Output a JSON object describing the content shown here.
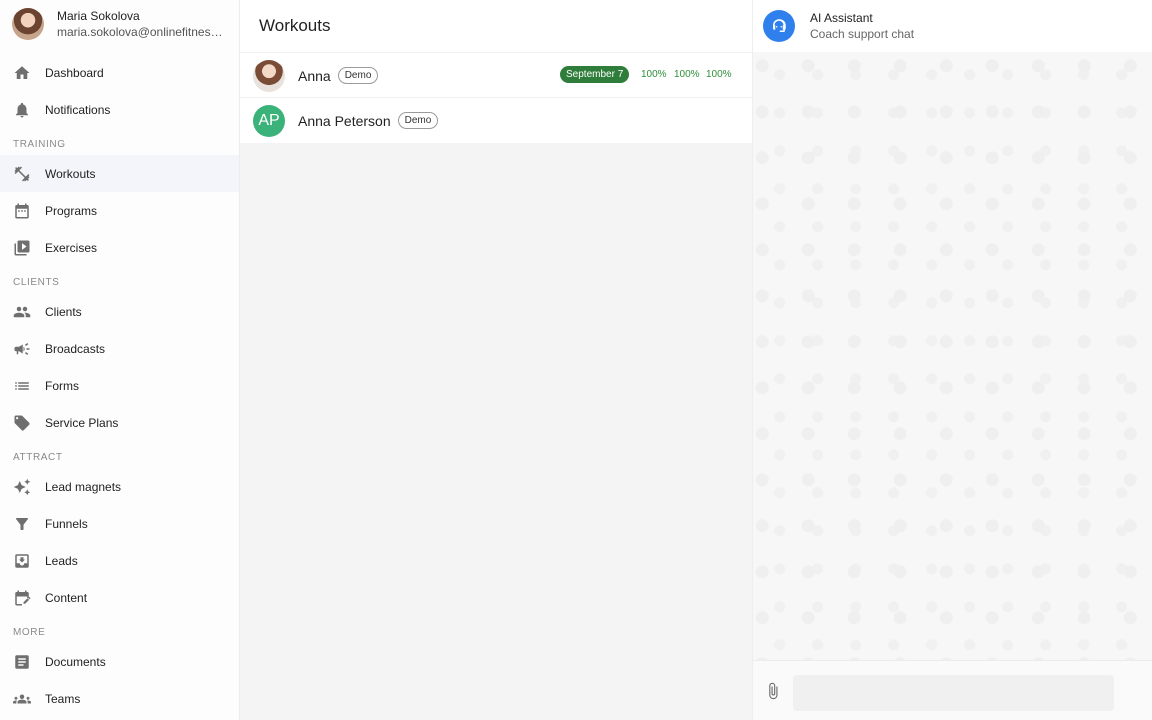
{
  "user": {
    "name": "Maria Sokolova",
    "email": "maria.sokolova@onlinefitness...."
  },
  "nav": {
    "dashboard": "Dashboard",
    "notifications": "Notifications",
    "section_training": "TRAINING",
    "workouts": "Workouts",
    "programs": "Programs",
    "exercises": "Exercises",
    "section_clients": "CLIENTS",
    "clients": "Clients",
    "broadcasts": "Broadcasts",
    "forms": "Forms",
    "service_plans": "Service Plans",
    "section_attract": "ATTRACT",
    "lead_magnets": "Lead magnets",
    "funnels": "Funnels",
    "leads": "Leads",
    "content": "Content",
    "section_more": "MORE",
    "documents": "Documents",
    "teams": "Teams"
  },
  "workouts": {
    "title": "Workouts",
    "rows": [
      {
        "name": "Anna",
        "badge": "Demo",
        "date": "September 7",
        "percents": [
          "100%",
          "100%",
          "100%"
        ]
      },
      {
        "name": "Anna Peterson",
        "initials": "AP",
        "badge": "Demo"
      }
    ]
  },
  "chat": {
    "title": "AI Assistant",
    "subtitle": "Coach support chat",
    "input_placeholder": ""
  },
  "colors": {
    "accent_green": "#2f7d3a",
    "percent_green": "#2f8f3a",
    "avatar_green": "#3bb27a",
    "assistant_blue": "#2f80ed",
    "active_nav_bg": "#f3f5fa"
  }
}
